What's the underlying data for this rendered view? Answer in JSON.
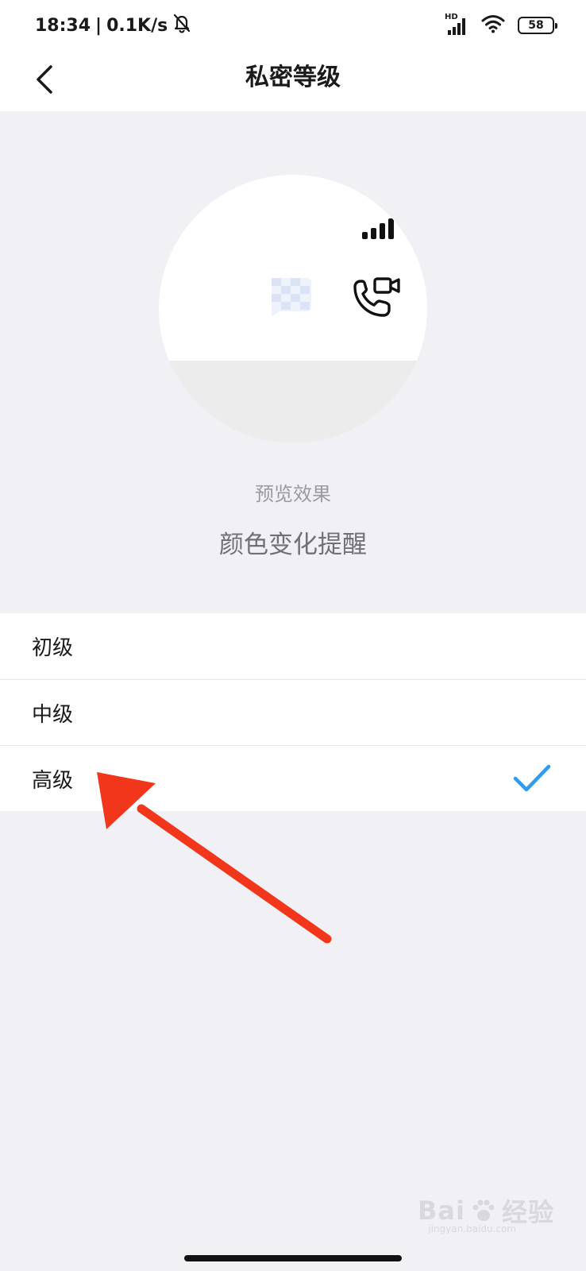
{
  "status_bar": {
    "time": "18:34",
    "separator": "|",
    "net_speed": "0.1K/s",
    "hd_label": "HD",
    "battery_level": "58"
  },
  "nav": {
    "title": "私密等级"
  },
  "preview": {
    "caption": "预览效果",
    "effect": "颜色变化提醒"
  },
  "levels": [
    {
      "label": "初级",
      "selected": false
    },
    {
      "label": "中级",
      "selected": false
    },
    {
      "label": "高级",
      "selected": true
    }
  ],
  "colors": {
    "accent_check": "#2f9bf3",
    "annotation_arrow": "#f2361c",
    "page_background": "#f0f0f5"
  },
  "watermark": {
    "brand": "Bai",
    "brand_tail": "经验",
    "domain": "jingyan.baidu.com"
  }
}
